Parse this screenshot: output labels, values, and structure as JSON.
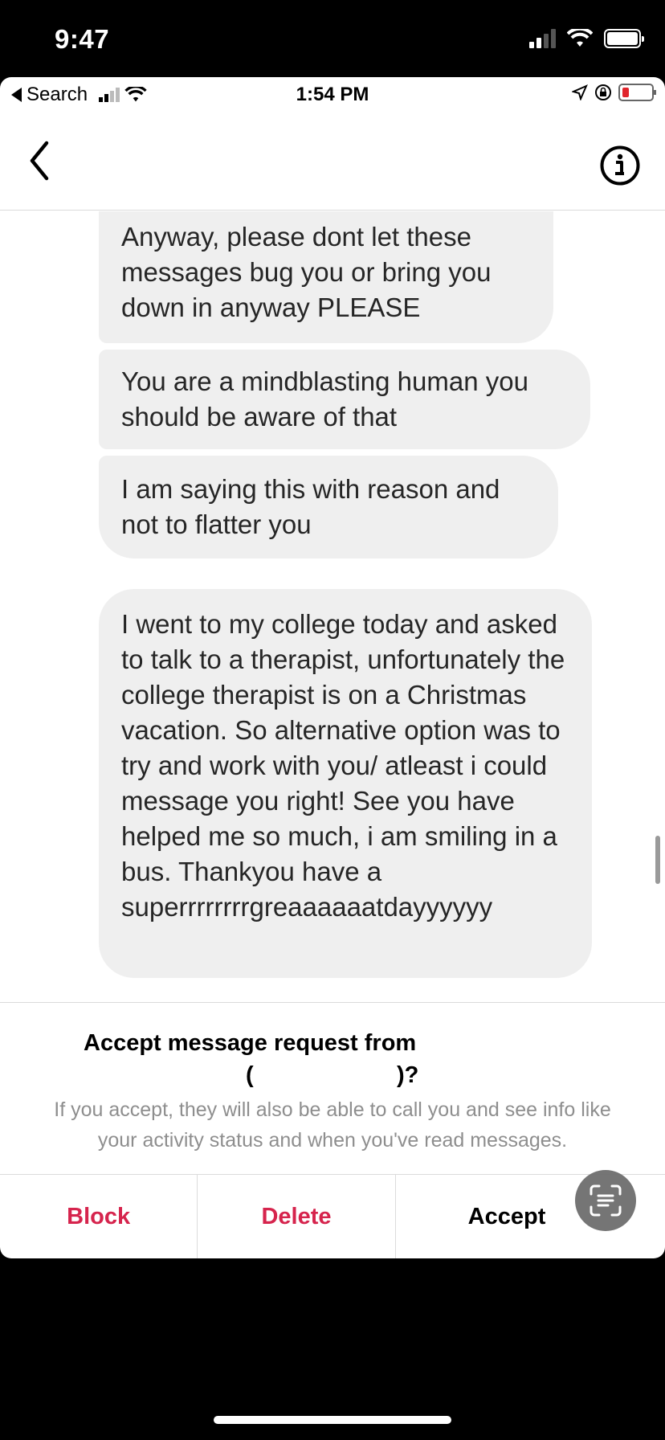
{
  "device_status": {
    "time": "9:47"
  },
  "screen_status": {
    "back_label": "Search",
    "time": "1:54 PM"
  },
  "messages": [
    {
      "text": "Anyway, please dont let these messages bug you or bring you down in anyway PLEASE"
    },
    {
      "text": "You are a mindblasting human you should be aware of that"
    },
    {
      "text": "I am saying this with reason and not to flatter you"
    },
    {
      "text": "I went to my college today and asked to talk to a therapist, unfortunately the college therapist is on a Christmas vacation. So alternative option was to try and work with you/ atleast i could message you right! See you have helped me so much, i am smiling in a bus. Thankyou have a superrrrrrrrgreaaaaaatdayyyyyy"
    }
  ],
  "request": {
    "title": "Accept message request from",
    "paren_open": "(",
    "paren_close": ")?",
    "note": "If you accept, they will also be able to call you and see info like your activity status and when you've read messages."
  },
  "actions": {
    "block": "Block",
    "delete": "Delete",
    "accept": "Accept"
  },
  "colors": {
    "destructive": "#d6244d",
    "bubble": "#efefef"
  },
  "icons": [
    "back-chevron-icon",
    "info-icon",
    "scan-text-icon",
    "signal-icon",
    "wifi-icon",
    "battery-icon",
    "location-icon",
    "orientation-lock-icon"
  ]
}
